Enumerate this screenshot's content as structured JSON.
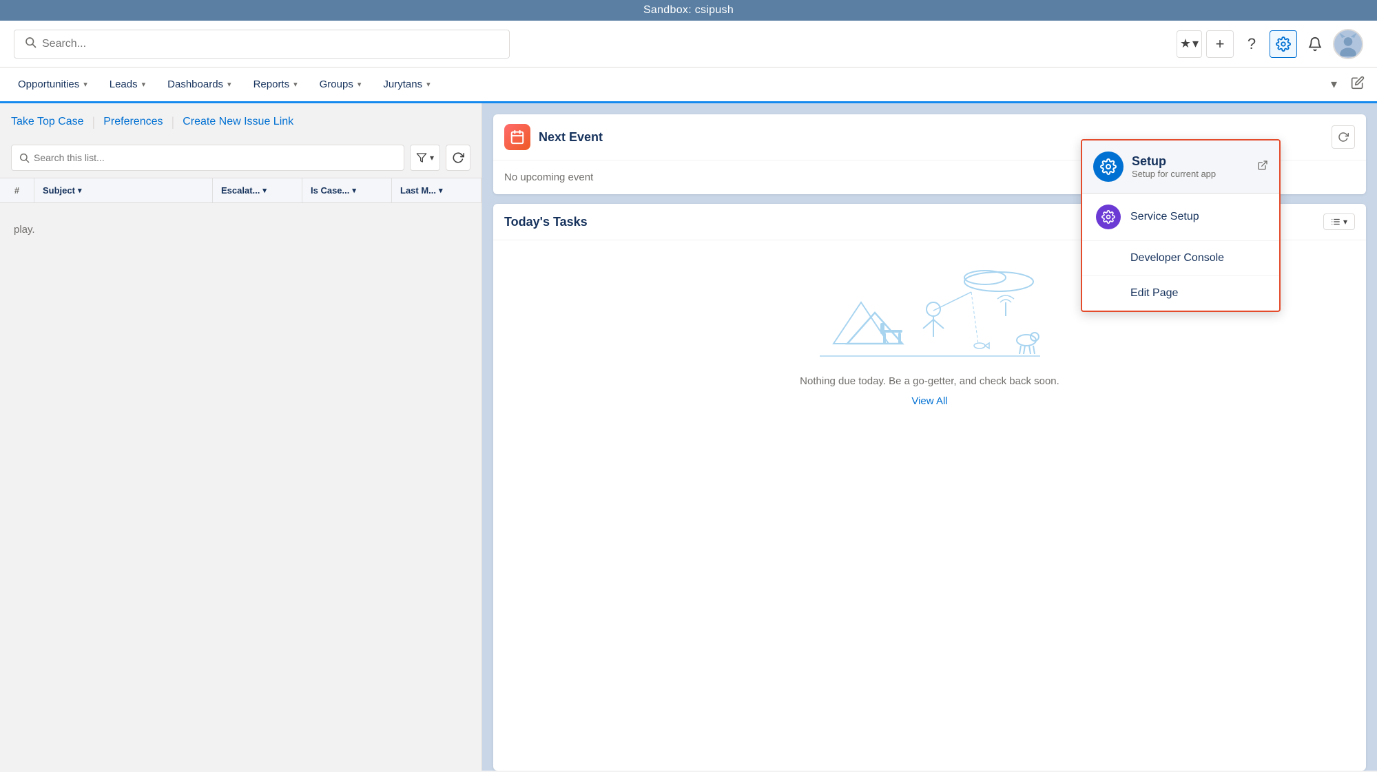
{
  "banner": {
    "text": "Sandbox: csipush"
  },
  "header": {
    "search_placeholder": "Search...",
    "buttons": {
      "star": "★",
      "chevron": "▾",
      "add": "+",
      "help": "?",
      "gear": "⚙",
      "bell": "🔔",
      "avatar": "🐱"
    }
  },
  "nav": {
    "items": [
      {
        "label": "Opportunities",
        "id": "opportunities"
      },
      {
        "label": "Leads",
        "id": "leads"
      },
      {
        "label": "Dashboards",
        "id": "dashboards"
      },
      {
        "label": "Reports",
        "id": "reports"
      },
      {
        "label": "Groups",
        "id": "groups"
      },
      {
        "label": "Jurytans",
        "id": "jurytans"
      }
    ]
  },
  "left_panel": {
    "actions": {
      "take_top_case": "Take Top Case",
      "preferences": "Preferences",
      "create_new_issue_link": "Create New Issue Link"
    },
    "search_placeholder": "Search this list...",
    "columns": {
      "subject": "Subject",
      "escalat": "Escalat...",
      "iscase": "Is Case...",
      "lastmod": "Last M..."
    },
    "empty_text": "play."
  },
  "right_panel": {
    "next_event": {
      "title": "Next Event",
      "empty_text": "No upcoming event"
    },
    "tasks": {
      "title": "Today's Tasks",
      "empty_text": "Nothing due today. Be a go-getter, and check back soon.",
      "view_all": "View All"
    }
  },
  "dropdown": {
    "setup": {
      "title": "Setup",
      "subtitle": "Setup for current app",
      "icon": "⚙"
    },
    "service_setup": {
      "label": "Service Setup",
      "icon": "⚙"
    },
    "developer_console": {
      "label": "Developer Console"
    },
    "edit_page": {
      "label": "Edit Page"
    }
  }
}
